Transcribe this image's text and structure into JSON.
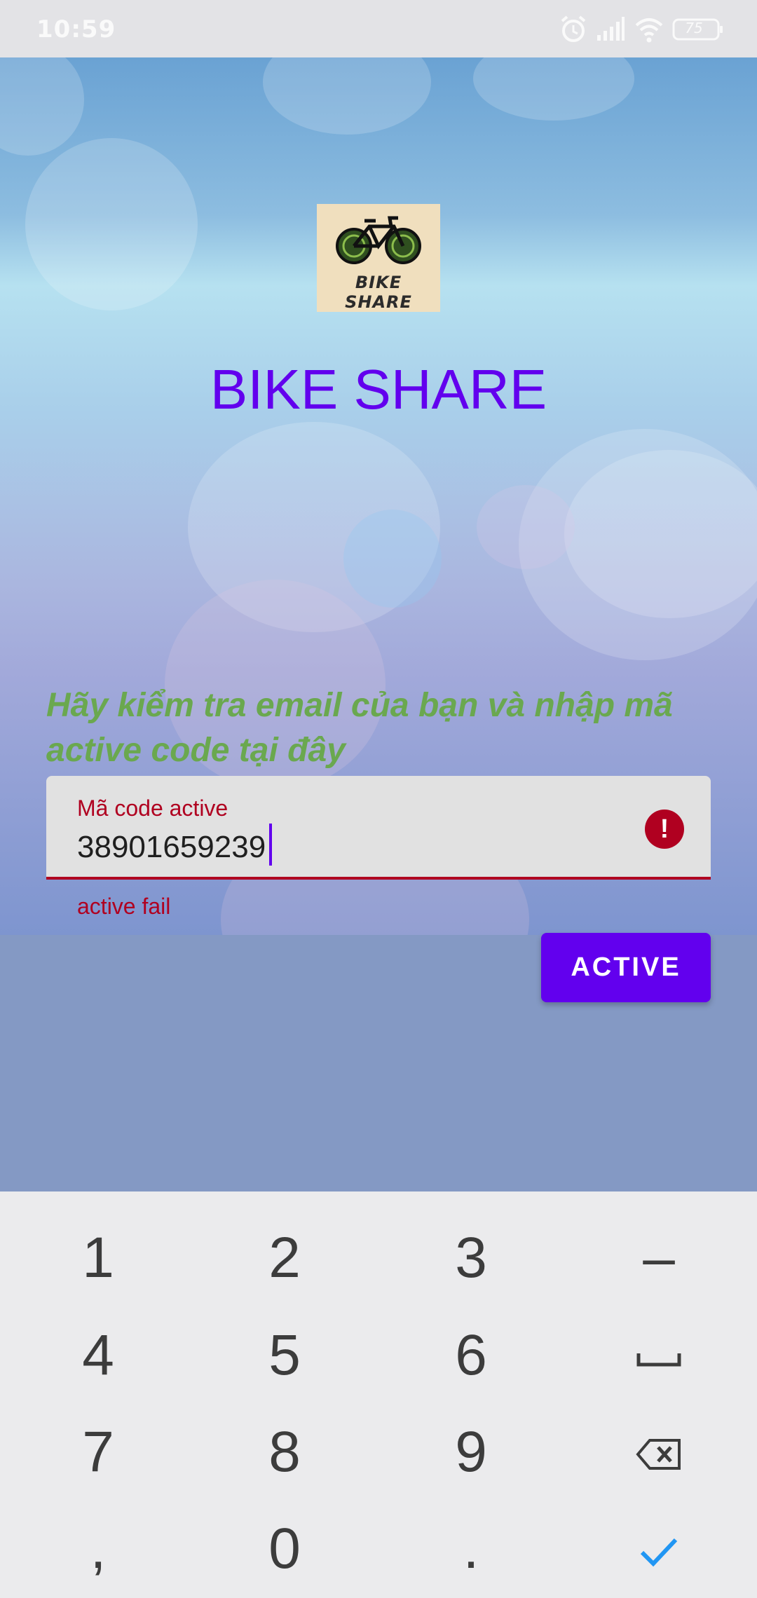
{
  "status_bar": {
    "time": "10:59",
    "battery": "75",
    "icons": [
      "alarm-icon",
      "signal-icon",
      "wifi-icon",
      "battery-icon"
    ]
  },
  "logo": {
    "text": "BIKE SHARE"
  },
  "app": {
    "title": "BIKE SHARE",
    "instruction": "Hãy kiểm tra email của bạn và nhập mã active code tại đây"
  },
  "form": {
    "label": "Mã code active",
    "value": "38901659239",
    "error_icon": "!",
    "helper": "active fail",
    "button": "ACTIVE"
  },
  "colors": {
    "primary": "#6200ee",
    "error": "#b00020",
    "instruction": "#6aa84f"
  },
  "keyboard": {
    "rows": [
      [
        "1",
        "2",
        "3",
        "–"
      ],
      [
        "4",
        "5",
        "6",
        "␣"
      ],
      [
        "7",
        "8",
        "9",
        "⌫"
      ],
      [
        ",",
        "0",
        ".",
        "✓"
      ]
    ]
  }
}
